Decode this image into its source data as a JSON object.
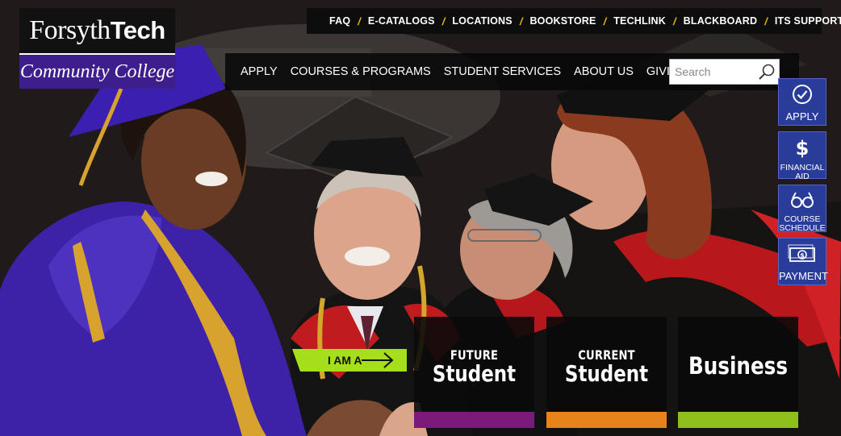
{
  "brand": {
    "name_regular": "Forsyth",
    "name_bold": "Tech",
    "subtitle": "Community College",
    "colors": {
      "purple": "#3e1e8c",
      "black": "#111111"
    }
  },
  "utility_nav": {
    "items": [
      "FAQ",
      "E-CATALOGS",
      "LOCATIONS",
      "BOOKSTORE",
      "TECHLINK",
      "BLACKBOARD",
      "ITS SUPPORT"
    ],
    "separator": "/",
    "separator_color": "#e8b90e"
  },
  "main_nav": {
    "items": [
      "APPLY",
      "COURSES & PROGRAMS",
      "STUDENT SERVICES",
      "ABOUT US",
      "GIVING"
    ]
  },
  "search": {
    "placeholder": "Search",
    "icon": "search-icon"
  },
  "quick_links": [
    {
      "label": "APPLY",
      "icon": "check-circle-icon"
    },
    {
      "label": "FINANCIAL AID",
      "icon": "dollar-icon"
    },
    {
      "label": "COURSE SCHEDULE",
      "icon": "glasses-icon"
    },
    {
      "label": "PAYMENT",
      "icon": "money-bill-icon"
    }
  ],
  "quick_links_color": "#2a3c9a",
  "audience": {
    "prompt": "I AM A",
    "prompt_color": "#a5de1a",
    "tiles": [
      {
        "line1": "FUTURE",
        "line2": "Student",
        "accent": "#7c1a7a"
      },
      {
        "line1": "CURRENT",
        "line2": "Student",
        "accent": "#e8821a"
      },
      {
        "line1": "",
        "line2": "Business",
        "accent": "#8fbf1a"
      }
    ]
  }
}
